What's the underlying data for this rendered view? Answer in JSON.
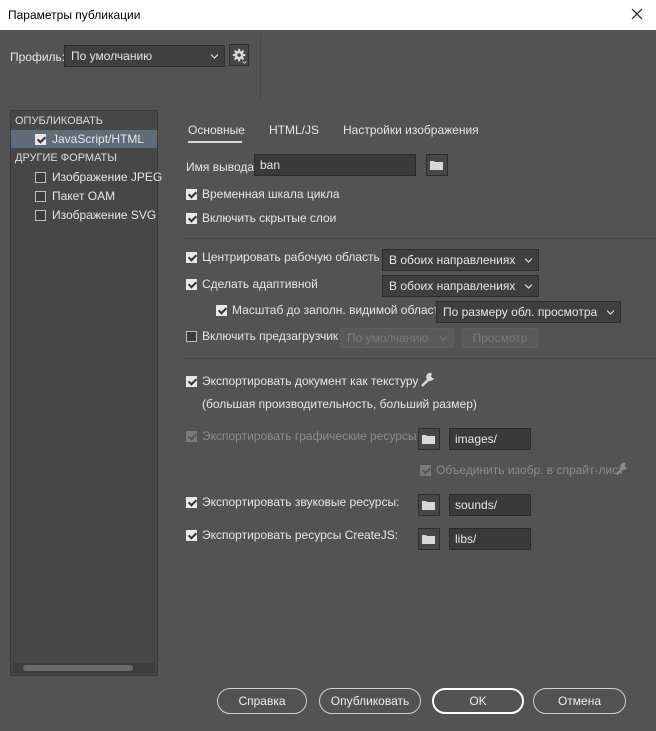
{
  "window": {
    "title": "Параметры публикации"
  },
  "profile": {
    "label": "Профиль:",
    "value": "По умолчанию"
  },
  "left_panel": {
    "publish_header": "ОПУБЛИКОВАТЬ",
    "publish_items": [
      {
        "label": "JavaScript/HTML",
        "checked": true
      }
    ],
    "other_header": "ДРУГИЕ ФОРМАТЫ",
    "other_items": [
      {
        "label": "Изображение JPEG",
        "checked": false
      },
      {
        "label": "Пакет OAM",
        "checked": false
      },
      {
        "label": "Изображение SVG",
        "checked": false
      }
    ]
  },
  "tabs": {
    "basic": "Основные",
    "html": "HTML/JS",
    "image": "Настройки изображения"
  },
  "output": {
    "label": "Имя вывода:",
    "value": "ban"
  },
  "options": {
    "loop": "Временная шкала цикла",
    "hidden_layers": "Включить скрытые слои",
    "center_stage": "Центрировать рабочую область",
    "center_value": "В обоих направлениях",
    "responsive": "Сделать адаптивной",
    "responsive_value": "В обоих направлениях",
    "scale": "Масштаб до заполн. видимой области",
    "scale_value": "По размеру обл. просмотра",
    "preloader": "Включить предзагрузчик",
    "preloader_value": "По умолчанию",
    "preview": "Просмотр"
  },
  "export": {
    "texture": "Экспортировать документ как текстуру",
    "texture_note": "(большая производительность, больший размер)",
    "images": "Экспортировать графические ресурсы:",
    "images_path": "images/",
    "spritesheet": "Объединить изобр. в спрайт-лист",
    "sounds": "Экспортировать звуковые ресурсы:",
    "sounds_path": "sounds/",
    "createjs": "Экспортировать ресурсы CreateJS:",
    "createjs_path": "libs/"
  },
  "buttons": {
    "help": "Справка",
    "publish": "Опубликовать",
    "ok": "OK",
    "cancel": "Отмена"
  }
}
